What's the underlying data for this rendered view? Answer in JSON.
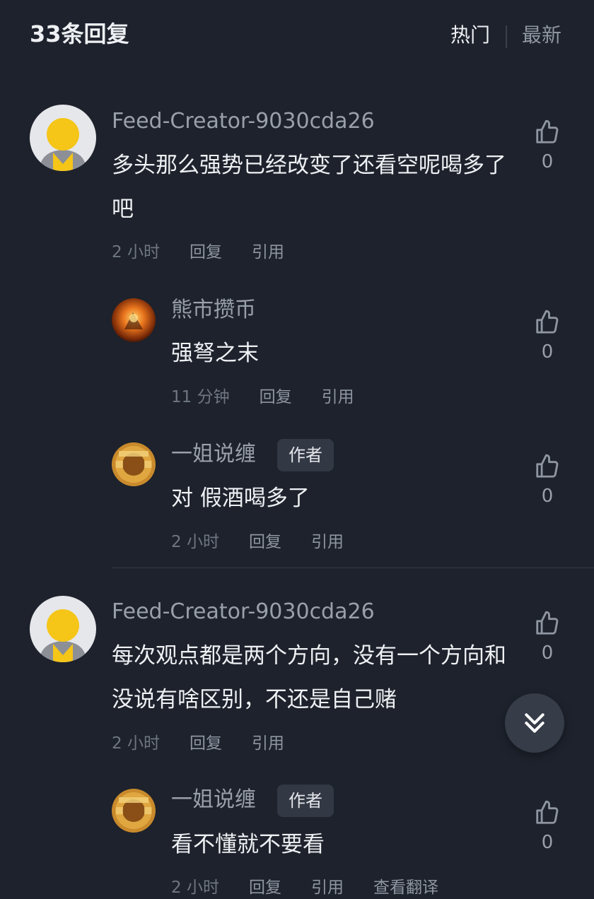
{
  "header": {
    "reply_count": "33条回复",
    "sort_hot": "热门",
    "sort_new": "最新"
  },
  "comments": [
    {
      "username": "Feed-Creator-9030cda26",
      "text": "多头那么强势已经改变了还看空呢喝多了吧",
      "time": "2 小时",
      "reply": "回复",
      "quote": "引用",
      "likes": "0",
      "replies": [
        {
          "username": "熊市攒币",
          "text": "强弩之末",
          "time": "11 分钟",
          "reply": "回复",
          "quote": "引用",
          "likes": "0"
        },
        {
          "username": "一姐说缠",
          "badge": "作者",
          "text": "对 假酒喝多了",
          "time": "2 小时",
          "reply": "回复",
          "quote": "引用",
          "likes": "0"
        }
      ]
    },
    {
      "username": "Feed-Creator-9030cda26",
      "text": "每次观点都是两个方向，没有一个方向和没说有啥区别，不还是自己赌",
      "time": "2 小时",
      "reply": "回复",
      "quote": "引用",
      "likes": "0",
      "replies": [
        {
          "username": "一姐说缠",
          "badge": "作者",
          "text": "看不懂就不要看",
          "time": "2 小时",
          "reply": "回复",
          "quote": "引用",
          "translate": "查看翻译",
          "likes": "0"
        }
      ]
    }
  ],
  "icons": {
    "like": "thumbs-up-icon",
    "scroll": "double-chevron-down-icon",
    "default_avatar": "default-avatar-icon"
  },
  "colors": {
    "background": "#1d222c",
    "avatar_yellow": "#f5c518",
    "badge_bg": "#323844"
  }
}
